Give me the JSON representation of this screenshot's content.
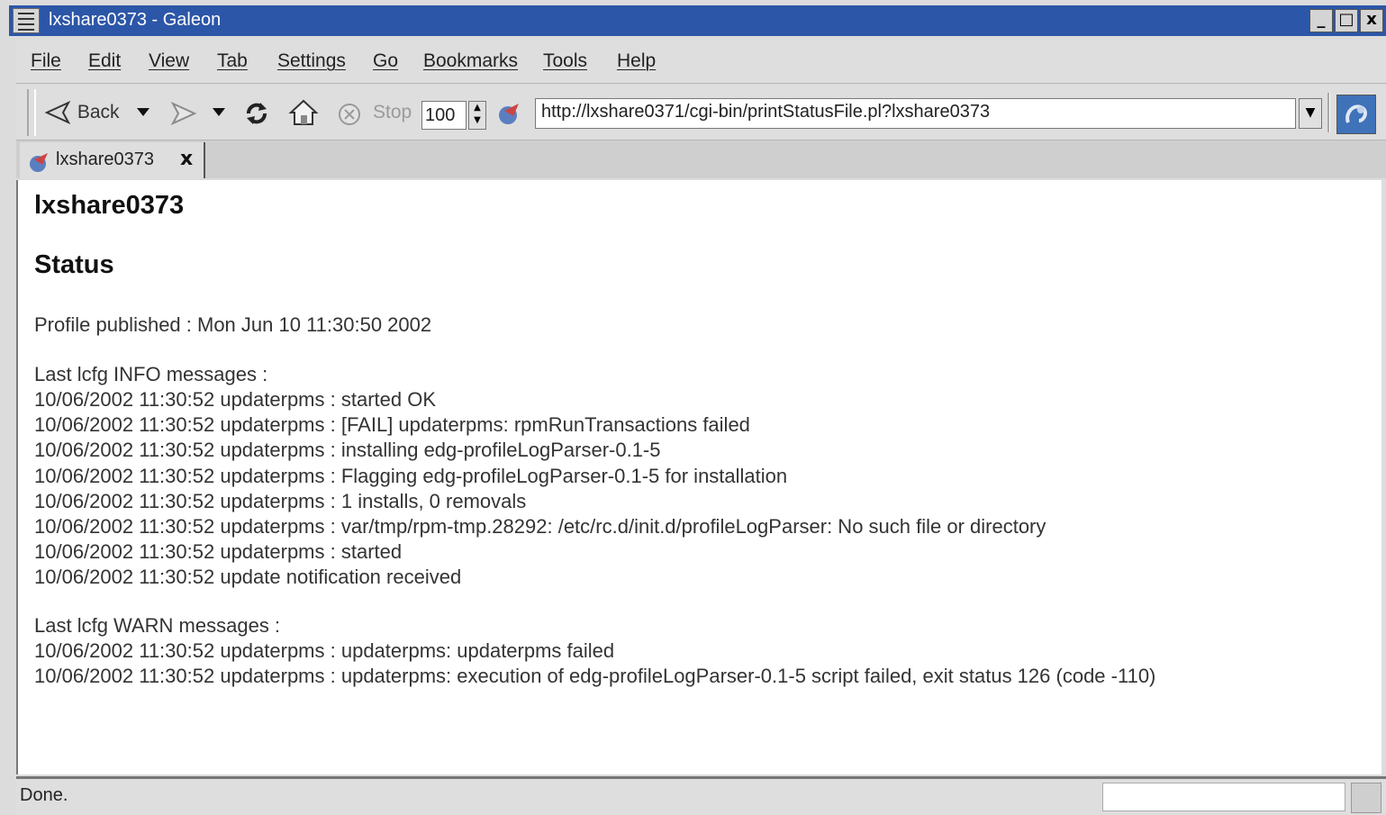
{
  "window": {
    "title": "lxshare0373 - Galeon",
    "minimize": "_",
    "maximize": "□",
    "close": "x"
  },
  "menubar": {
    "items": [
      "File",
      "Edit",
      "View",
      "Tab",
      "Settings",
      "Go",
      "Bookmarks",
      "Tools",
      "Help"
    ]
  },
  "toolbar": {
    "back_label": "Back",
    "stop_label": "Stop",
    "zoom_value": "100",
    "url": "http://lxshare0371/cgi-bin/printStatusFile.pl?lxshare0373"
  },
  "tab": {
    "label": "lxshare0373",
    "close": "x"
  },
  "content": {
    "title": "lxshare0373",
    "status_heading": "Status",
    "profile_published": "Profile published : Mon Jun 10 11:30:50 2002",
    "info_heading": "Last lcfg INFO messages :",
    "info_messages": [
      "10/06/2002 11:30:52 updaterpms : started OK",
      "10/06/2002 11:30:52 updaterpms : [FAIL] updaterpms: rpmRunTransactions failed",
      "10/06/2002 11:30:52 updaterpms : installing edg-profileLogParser-0.1-5",
      "10/06/2002 11:30:52 updaterpms : Flagging edg-profileLogParser-0.1-5 for installation",
      "10/06/2002 11:30:52 updaterpms : 1 installs, 0 removals",
      "10/06/2002 11:30:52 updaterpms : var/tmp/rpm-tmp.28292: /etc/rc.d/init.d/profileLogParser: No such file or directory",
      "10/06/2002 11:30:52 updaterpms : started",
      "10/06/2002 11:30:52 update notification received"
    ],
    "warn_heading": "Last lcfg WARN messages :",
    "warn_messages": [
      "10/06/2002 11:30:52 updaterpms : updaterpms: updaterpms failed",
      "10/06/2002 11:30:52 updaterpms : updaterpms: execution of edg-profileLogParser-0.1-5 script failed, exit status 126 (code -110)"
    ]
  },
  "statusbar": {
    "text": "Done."
  }
}
